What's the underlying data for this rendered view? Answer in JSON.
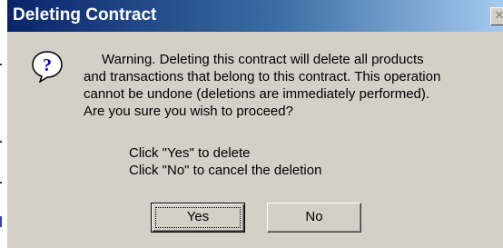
{
  "dialog": {
    "title": "Deleting Contract",
    "close_glyph": "✕",
    "icon": "question-icon",
    "message_lines": [
      "Warning. Deleting this contract will delete all products",
      "and transactions that belong to this contract. This operation",
      "cannot be undone (deletions are immediately performed).",
      "Are you sure you wish to proceed?"
    ],
    "instructions": [
      "Click \"Yes\" to delete",
      "Click \"No\" to cancel the deletion"
    ],
    "buttons": {
      "yes": "Yes",
      "no": "No"
    },
    "colors": {
      "title_bar_start": "#0a246a",
      "title_bar_end": "#a6caf0",
      "face": "#d4d0c8"
    }
  }
}
